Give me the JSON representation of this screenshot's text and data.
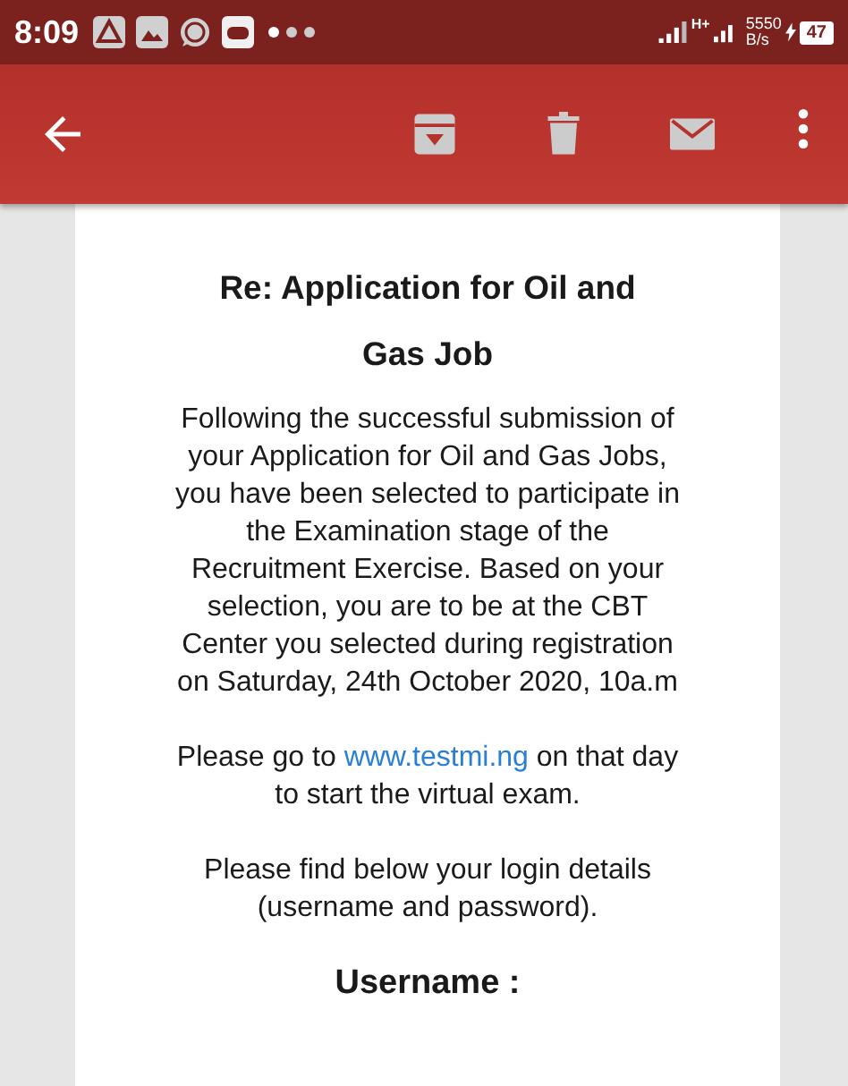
{
  "status_bar": {
    "time": "8:09",
    "notifications": [
      {
        "kind": "triangle"
      },
      {
        "kind": "image"
      },
      {
        "kind": "chat"
      },
      {
        "kind": "gamepad"
      }
    ],
    "network": "H+",
    "speed": "5550",
    "speed_unit": "B/s",
    "battery": "47"
  },
  "toolbar": {
    "actions": [
      {
        "kind": "archive"
      },
      {
        "kind": "delete"
      },
      {
        "kind": "mail"
      },
      {
        "kind": "more"
      }
    ]
  },
  "email": {
    "subject": "Re: Application for Oil and Gas Job",
    "body": "Following the successful submission of your Application for Oil and Gas Jobs, you have been selected to participate in the Examination stage of the Recruitment Exercise. Based on your selection, you are to be at the CBT Center you selected during registration on Saturday, 24th October 2020, 10a.m",
    "link_paragraph": {
      "before": "Please go to",
      "link": "www.testmi.ng",
      "after": "on that day to start the virtual exam."
    },
    "login_note": "Please find below your login details (username and password).",
    "field_label": "Username :"
  }
}
